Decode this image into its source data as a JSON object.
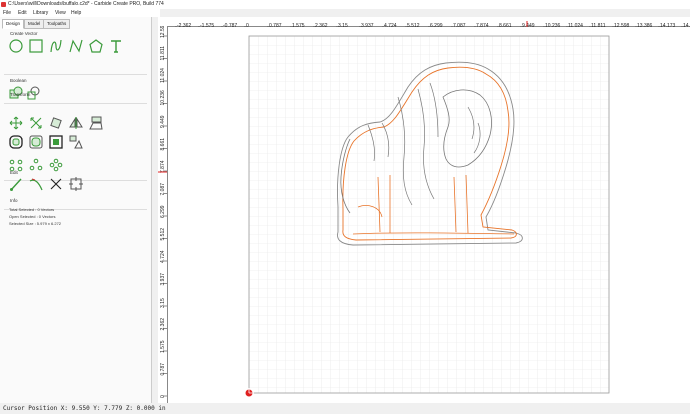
{
  "window": {
    "title": "C:\\Users\\will\\Downloads\\buffalo.c2d* - Carbide Create PRO, Build 774"
  },
  "menu": [
    "File",
    "Edit",
    "Library",
    "View",
    "Help"
  ],
  "tabs": [
    "Design",
    "Model",
    "Toolpaths"
  ],
  "sections": {
    "create_vector": "Create Vector",
    "boolean": "Boolean",
    "transform": "Transform",
    "edit": "Edit",
    "info": "Info"
  },
  "info": {
    "total_selected": "Total Selected : 0 Vectors",
    "open_selected": "Open Selected : 0 Vectors",
    "selected_size": "Selected Size : 5.979 x 6.272"
  },
  "ruler": {
    "top_labels": [
      "-2.362",
      "-1.575",
      "-0.787",
      "0",
      "0.787",
      "1.575",
      "2.362",
      "3.15",
      "3.937",
      "4.724",
      "5.512",
      "6.299",
      "7.087",
      "7.874",
      "8.661",
      "9.449",
      "10.236",
      "11.024",
      "11.811",
      "12.598",
      "13.386",
      "14.173",
      "14.961"
    ],
    "left_labels": [
      "12.598",
      "11.811",
      "11.024",
      "10.236",
      "9.449",
      "8.661",
      "7.874",
      "7.087",
      "6.299",
      "5.512",
      "4.724",
      "3.937",
      "3.15",
      "2.362",
      "1.575",
      "0.787",
      "0"
    ]
  },
  "status": {
    "cursor_position": "Cursor Position X: 9.550 Y: 7.779 Z: 0.000 in"
  },
  "colors": {
    "accent_green": "#3a9a3a",
    "orange_vector": "#e8742a",
    "grey_vector": "#7a7a7a",
    "grid_line": "#d9d9d9",
    "origin_red": "#e02020"
  },
  "icons": {
    "create_vector": [
      "circle-icon",
      "rectangle-icon",
      "curve-icon",
      "polyline-icon",
      "polygon-icon",
      "text-icon"
    ],
    "boolean": [
      "union-icon",
      "weld-icon"
    ],
    "transform": [
      "move-icon",
      "scale-icon",
      "rotate-icon",
      "mirror-icon",
      "align-icon",
      "offset-icon",
      "fillet-icon",
      "inset-icon",
      "group-icon",
      "node-icon",
      "array-icon",
      "pattern-icon"
    ],
    "edit": [
      "trim-icon",
      "join-icon",
      "cut-icon",
      "frame-icon"
    ]
  }
}
